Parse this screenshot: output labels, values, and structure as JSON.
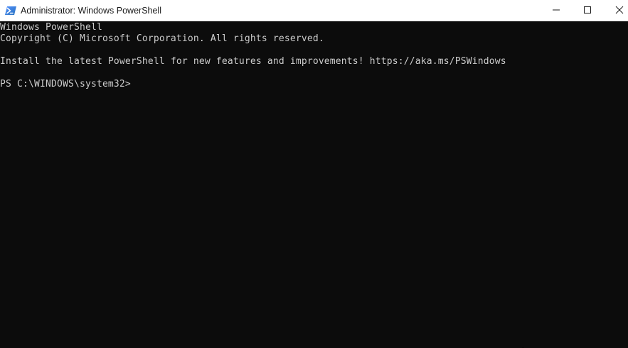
{
  "window": {
    "title": "Administrator: Windows PowerShell"
  },
  "icons": {
    "app": "powershell-icon",
    "minimize": "minimize-icon",
    "maximize": "maximize-icon",
    "close": "close-icon",
    "pointer": "mouse-pointer-icon"
  },
  "colors": {
    "console_bg": "#0c0c0c",
    "console_text": "#cccccc",
    "titlebar_bg": "#ffffff",
    "powershell_blue": "#2671be"
  },
  "console": {
    "lines": [
      "Windows PowerShell",
      "Copyright (C) Microsoft Corporation. All rights reserved.",
      "Install the latest PowerShell for new features and improvements! https://aka.ms/PSWindows",
      "PS C:\\WINDOWS\\system32>"
    ]
  }
}
